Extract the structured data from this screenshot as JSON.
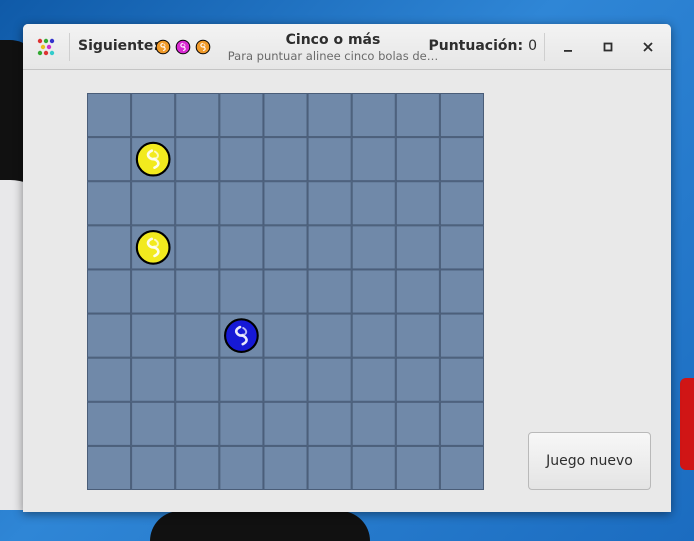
{
  "window": {
    "title": "Cinco o más",
    "subtitle": "Para puntuar alinee cinco bolas de…",
    "app_icon": "five-or-more-app-icon",
    "controls": {
      "minimize": "minimize-icon",
      "maximize": "maximize-icon",
      "close": "close-icon"
    }
  },
  "header": {
    "next_label": "Siguiente:",
    "next_balls": [
      "orange",
      "magenta",
      "orange"
    ],
    "score_label": "Puntuación:",
    "score_value": "0"
  },
  "board": {
    "rows": 9,
    "cols": 9,
    "cell_color": "#7089a9",
    "grid_color": "#4a5d78",
    "balls": [
      {
        "row": 1,
        "col": 1,
        "color": "yellow"
      },
      {
        "row": 3,
        "col": 1,
        "color": "yellow"
      },
      {
        "row": 5,
        "col": 3,
        "color": "blue"
      }
    ]
  },
  "colors": {
    "yellow": "#f2ea1e",
    "blue": "#1619d6",
    "orange": "#f09a2a",
    "magenta": "#d92ad2"
  },
  "buttons": {
    "new_game": "Juego nuevo"
  }
}
